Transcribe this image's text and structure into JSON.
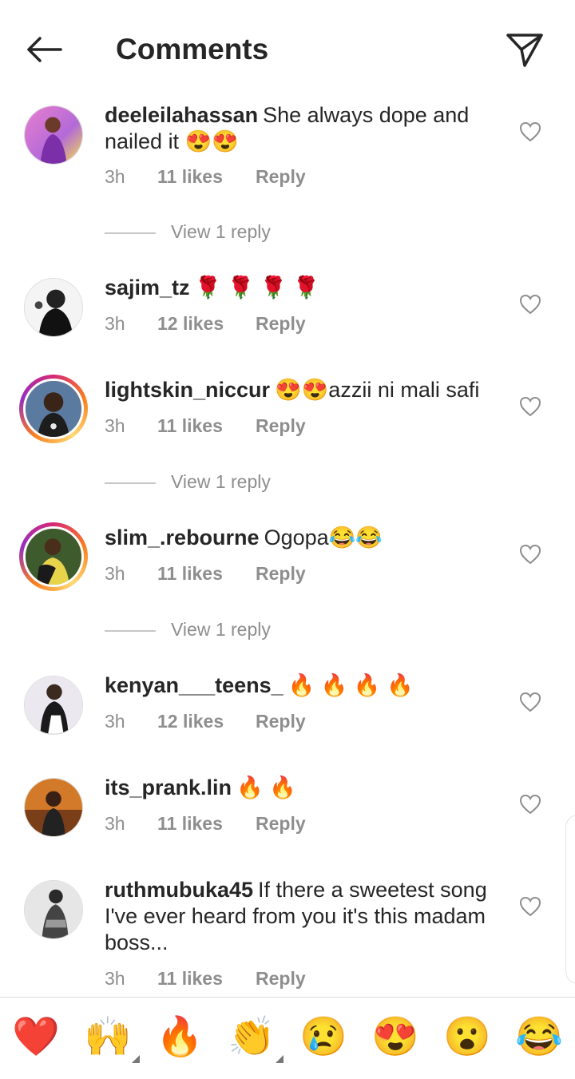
{
  "header": {
    "title": "Comments",
    "back_icon": "arrow-left-icon",
    "send_icon": "paper-plane-icon"
  },
  "comments": [
    {
      "username": "deeleilahassan",
      "text": "She always dope and nailed it 😍😍",
      "time": "3h",
      "likes": "11 likes",
      "reply": "Reply",
      "view_replies": "View 1 reply",
      "story_ring": false
    },
    {
      "username": "sajim_tz",
      "text": "🌹 🌹 🌹 🌹",
      "time": "3h",
      "likes": "12 likes",
      "reply": "Reply",
      "story_ring": false
    },
    {
      "username": "lightskin_niccur",
      "text": "😍😍azzii ni mali safi",
      "time": "3h",
      "likes": "11 likes",
      "reply": "Reply",
      "view_replies": "View 1 reply",
      "story_ring": true
    },
    {
      "username": "slim_.rebourne",
      "text": "Ogopa😂😂",
      "time": "3h",
      "likes": "11 likes",
      "reply": "Reply",
      "view_replies": "View 1 reply",
      "story_ring": true
    },
    {
      "username": "kenyan___teens_",
      "text": "🔥 🔥 🔥 🔥",
      "time": "3h",
      "likes": "12 likes",
      "reply": "Reply",
      "story_ring": false
    },
    {
      "username": "its_prank.lin",
      "text": "🔥 🔥",
      "time": "3h",
      "likes": "11 likes",
      "reply": "Reply",
      "story_ring": false
    },
    {
      "username": "ruthmubuka45",
      "text": "If there a sweetest song I've ever heard from you it's this madam boss...",
      "time": "3h",
      "likes": "11 likes",
      "reply": "Reply",
      "story_ring": false
    }
  ],
  "reactions": [
    "❤️",
    "🙌",
    "🔥",
    "👏",
    "😢",
    "😍",
    "😮",
    "😂"
  ],
  "colors": {
    "text": "#262626",
    "secondary": "#8e8e8e",
    "divider": "#dbdbdb"
  }
}
